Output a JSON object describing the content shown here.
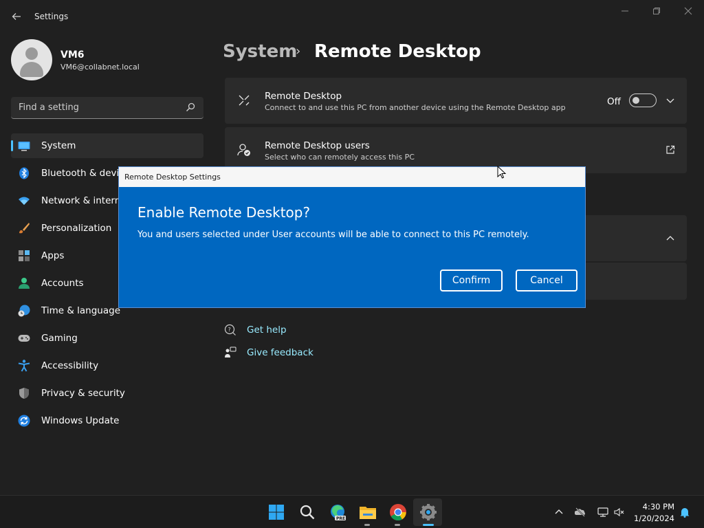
{
  "window": {
    "app_title": "Settings"
  },
  "profile": {
    "name": "VM6",
    "email": "VM6@collabnet.local"
  },
  "search": {
    "placeholder": "Find a setting"
  },
  "nav": {
    "items": [
      {
        "label": "System",
        "icon": "system-icon",
        "active": true
      },
      {
        "label": "Bluetooth & devices",
        "icon": "bluetooth-icon"
      },
      {
        "label": "Network & internet",
        "icon": "wifi-icon"
      },
      {
        "label": "Personalization",
        "icon": "brush-icon"
      },
      {
        "label": "Apps",
        "icon": "apps-icon"
      },
      {
        "label": "Accounts",
        "icon": "person-icon"
      },
      {
        "label": "Time & language",
        "icon": "globe-clock-icon"
      },
      {
        "label": "Gaming",
        "icon": "gamepad-icon"
      },
      {
        "label": "Accessibility",
        "icon": "accessibility-icon"
      },
      {
        "label": "Privacy & security",
        "icon": "shield-icon"
      },
      {
        "label": "Windows Update",
        "icon": "update-icon"
      }
    ]
  },
  "breadcrumb": {
    "parent": "System",
    "separator": "›",
    "current": "Remote Desktop"
  },
  "cards": {
    "remote_desktop": {
      "title": "Remote Desktop",
      "description": "Connect to and use this PC from another device using the Remote Desktop app",
      "toggle_state": "Off"
    },
    "remote_desktop_users": {
      "title": "Remote Desktop users",
      "description": "Select who can remotely access this PC"
    }
  },
  "help": {
    "get_help": "Get help",
    "give_feedback": "Give feedback"
  },
  "dialog": {
    "window_title": "Remote Desktop Settings",
    "heading": "Enable Remote Desktop?",
    "message": "You and users selected under User accounts will be able to connect to this PC remotely.",
    "confirm_label": "Confirm",
    "cancel_label": "Cancel"
  },
  "taskbar": {
    "apps": [
      "start-icon",
      "search-icon",
      "edge-preview-icon",
      "file-explorer-icon",
      "chrome-icon",
      "settings-icon"
    ],
    "time": "4:30 PM",
    "date": "1/20/2024"
  },
  "colors": {
    "accent": "#4cc2ff",
    "dialog_blue": "#0067c0",
    "link": "#99ebff"
  }
}
